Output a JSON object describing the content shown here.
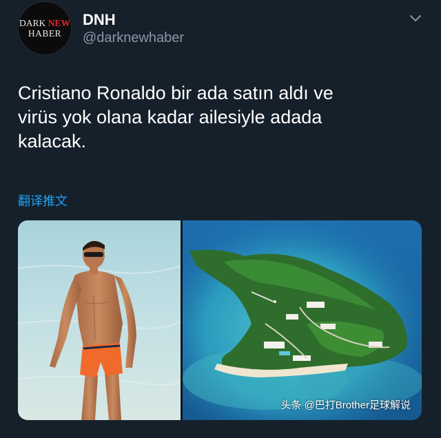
{
  "author": {
    "display_name": "DNH",
    "handle": "@darknewhaber",
    "avatar_logo": {
      "line1_a": "DARK",
      "line1_b": "NEW",
      "line2": "HABER"
    }
  },
  "tweet": {
    "text": "Cristiano Ronaldo bir ada satın aldı ve\nvirüs yok olana kadar ailesiyle adada\nkalacak.",
    "translate_label": "翻译推文"
  },
  "media": [
    {
      "name": "beach-photo"
    },
    {
      "name": "island-aerial-photo"
    }
  ],
  "watermark": "头条 @巴打Brother足球解说",
  "colors": {
    "background": "#15202b",
    "text": "#ffffff",
    "secondary": "#8899a6",
    "link": "#1da1f2",
    "logo_accent": "#e0262b"
  },
  "icons": {
    "menu": "chevron-down-icon"
  }
}
